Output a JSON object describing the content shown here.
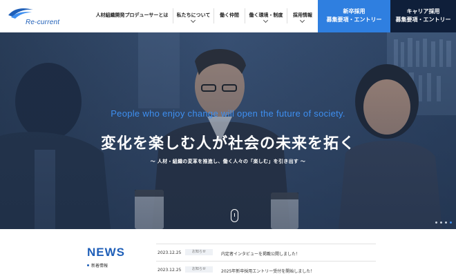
{
  "logo": {
    "text": "Re-current"
  },
  "nav": {
    "items": [
      {
        "label": "人材組織開発プロデューサーとは",
        "has_dropdown": false
      },
      {
        "label": "私たちについて",
        "has_dropdown": true
      },
      {
        "label": "働く仲間",
        "has_dropdown": false
      },
      {
        "label": "働く環境・制度",
        "has_dropdown": true
      },
      {
        "label": "採用情報",
        "has_dropdown": true
      }
    ]
  },
  "cta": {
    "new_grad": {
      "line1": "新卒採用",
      "line2": "募集要項・エントリー",
      "color": "#2f7fe0"
    },
    "career": {
      "line1": "キャリア採用",
      "line2": "募集要項・エントリー",
      "color": "#0f1f3a"
    }
  },
  "hero": {
    "tagline_en": "People who enjoy change will open the future of society.",
    "headline": "変化を楽しむ人が社会の未来を拓く",
    "subline": "～ 人材・組織の変革を推進し、働く人々の「楽しむ」を引き出す ～",
    "slides": {
      "count": 4,
      "active_index": 3
    }
  },
  "news": {
    "title": "NEWS",
    "category": "新着情報",
    "items": [
      {
        "date": "2023.12.25",
        "tag": "お知らせ",
        "text": "内定者インタビューを掲載公開しました！"
      },
      {
        "date": "2023.12.25",
        "tag": "お知らせ",
        "text": "2025年新卒採用エントリー受付を開始しました！"
      }
    ]
  },
  "colors": {
    "brand_blue": "#1f5fb8",
    "accent_blue": "#3e8ff0"
  }
}
